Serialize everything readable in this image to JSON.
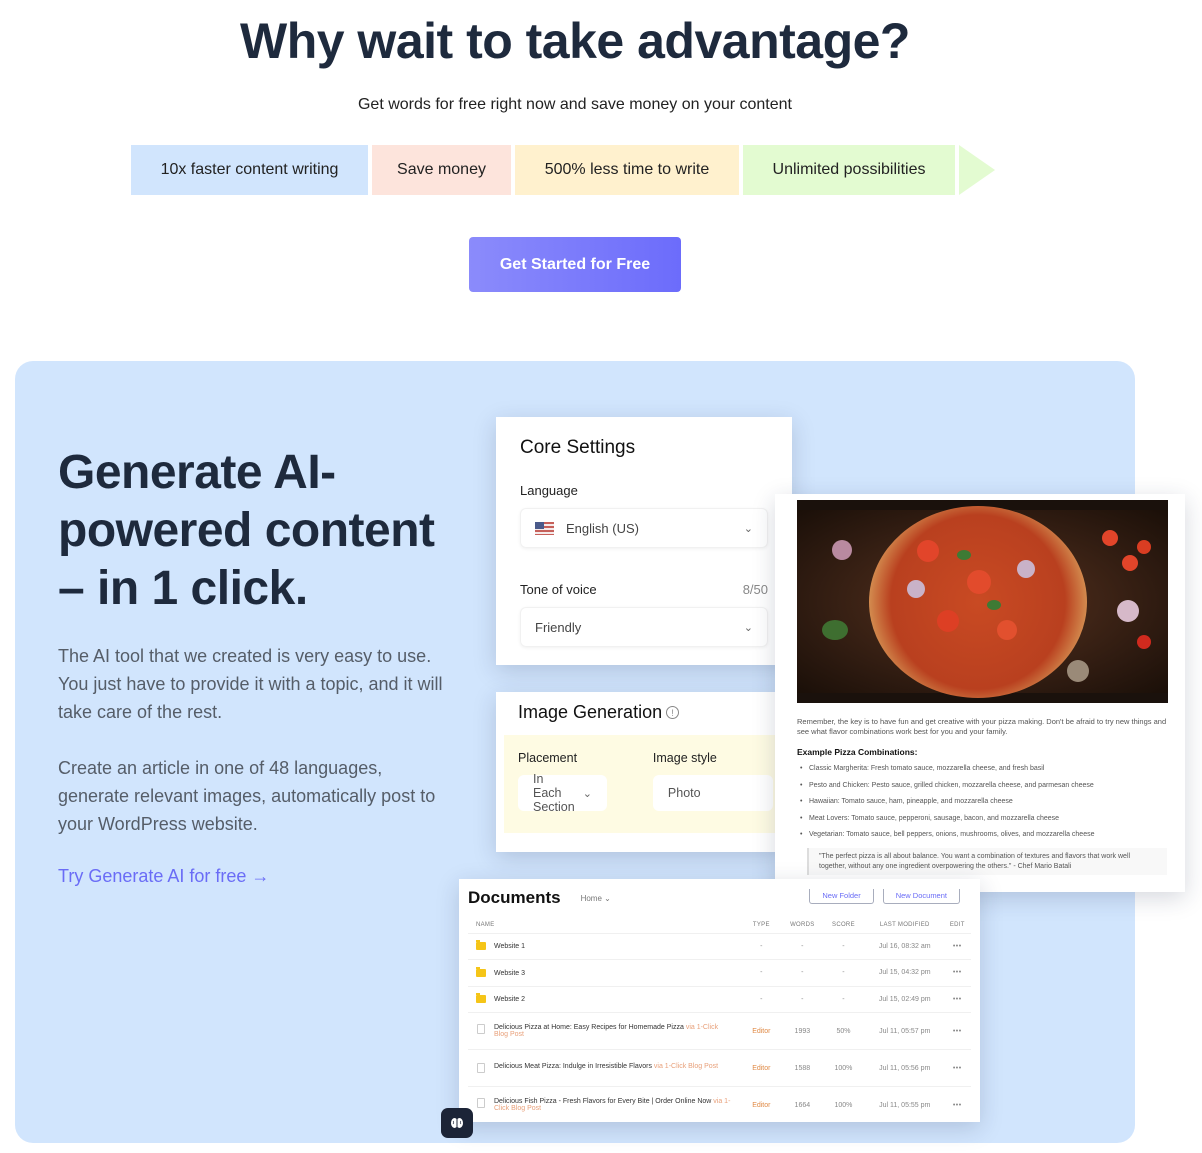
{
  "hero": {
    "title": "Why wait to take advantage?",
    "subtitle": "Get words for free right now and save money on your content"
  },
  "benefits": [
    {
      "label": "10x faster content writing",
      "color": "#d1e5fd"
    },
    {
      "label": "Save money",
      "color": "#fde4dc"
    },
    {
      "label": "500% less time to write",
      "color": "#fff1ce"
    },
    {
      "label": "Unlimited possibilities",
      "color": "#e3fbd1"
    }
  ],
  "cta": {
    "label": "Get Started for Free"
  },
  "panel": {
    "title": "Generate AI-powered content – in 1 click.",
    "paragraph1": "The AI tool that we created is very easy to use. You just have to provide it with a topic, and it will take care of the rest.",
    "paragraph2": "Create an article in one of 48 languages, generate relevant images, automatically post to your WordPress website.",
    "link": "Try Generate AI for free →",
    "bg_color": "#d1e5fd"
  },
  "core_settings": {
    "title": "Core Settings",
    "language_label": "Language",
    "language_value": "English (US)",
    "tone_label": "Tone of voice",
    "tone_count": "8/50",
    "tone_value": "Friendly"
  },
  "image_generation": {
    "title": "Image Generation",
    "placement_label": "Placement",
    "placement_value": "In Each Section",
    "style_label": "Image style",
    "style_value": "Photo"
  },
  "article": {
    "intro": "Remember, the key is to have fun and get creative with your pizza making. Don't be afraid to try new things and see what flavor combinations work best for you and your family.",
    "heading": "Example Pizza Combinations:",
    "items": [
      "Classic Margherita: Fresh tomato sauce, mozzarella cheese, and fresh basil",
      "Pesto and Chicken: Pesto sauce, grilled chicken, mozzarella cheese, and parmesan cheese",
      "Hawaiian: Tomato sauce, ham, pineapple, and mozzarella cheese",
      "Meat Lovers: Tomato sauce, pepperoni, sausage, bacon, and mozzarella cheese",
      "Vegetarian: Tomato sauce, bell peppers, onions, mushrooms, olives, and mozzarella cheese"
    ],
    "quote": "\"The perfect pizza is all about balance. You want a combination of textures and flavors that work well together, without any one ingredient overpowering the others.\" - Chef Mario Batali"
  },
  "documents": {
    "title": "Documents",
    "breadcrumb": "Home ⌄",
    "new_folder": "New Folder",
    "new_document": "New Document",
    "columns": [
      "NAME",
      "TYPE",
      "WORDS",
      "SCORE",
      "LAST MODIFIED",
      "EDIT"
    ],
    "rows": [
      {
        "kind": "folder",
        "name": "Website 1",
        "via": "",
        "type": "-",
        "words": "-",
        "score": "-",
        "modified": "Jul 16, 08:32 am",
        "edit": "•••"
      },
      {
        "kind": "folder",
        "name": "Website 3",
        "via": "",
        "type": "-",
        "words": "-",
        "score": "-",
        "modified": "Jul 15, 04:32 pm",
        "edit": "•••"
      },
      {
        "kind": "folder",
        "name": "Website 2",
        "via": "",
        "type": "-",
        "words": "-",
        "score": "-",
        "modified": "Jul 15, 02:49 pm",
        "edit": "•••"
      },
      {
        "kind": "doc",
        "name": "Delicious Pizza at Home: Easy Recipes for Homemade Pizza",
        "via": "via 1-Click Blog Post",
        "type": "Editor",
        "words": "1993",
        "score": "50%",
        "modified": "Jul 11, 05:57 pm",
        "edit": "•••"
      },
      {
        "kind": "doc",
        "name": "Delicious Meat Pizza: Indulge in Irresistible Flavors",
        "via": "via 1-Click Blog Post",
        "type": "Editor",
        "words": "1588",
        "score": "100%",
        "modified": "Jul 11, 05:56 pm",
        "edit": "•••"
      },
      {
        "kind": "doc",
        "name": "Delicious Fish Pizza - Fresh Flavors for Every Bite | Order Online Now",
        "via": "via 1-Click Blog Post",
        "type": "Editor",
        "words": "1664",
        "score": "100%",
        "modified": "Jul 11, 05:55 pm",
        "edit": "•••"
      }
    ]
  },
  "icons": {
    "chevron": "⌄",
    "info": "!",
    "brain": "brain-icon"
  }
}
